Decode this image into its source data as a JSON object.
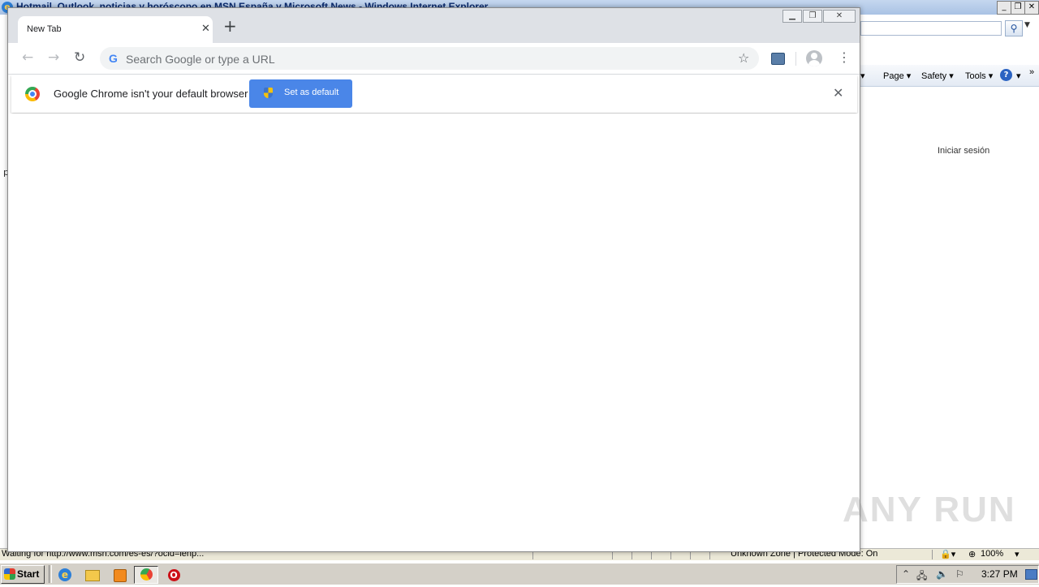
{
  "ie": {
    "title": "Hotmail, Outlook, noticias y horóscopo en MSN España y Microsoft News - Windows Internet Explorer",
    "menu": {
      "page": "Page",
      "safety": "Safety",
      "tools": "Tools"
    },
    "signin": "Iniciar sesión",
    "status": "Waiting for http://www.msn.com/es-es/?ocid=iehp...",
    "zone": "Unknown Zone | Protected Mode: On",
    "zoom": "100%",
    "left_fragment": "p"
  },
  "chrome": {
    "tab_title": "New Tab",
    "omnibox_placeholder": "Search Google or type a URL",
    "omnibox_value": "",
    "infobar_message": "Google Chrome isn't your default browser",
    "set_default_label": "Set as default"
  },
  "taskbar": {
    "start_label": "Start",
    "clock": "3:27 PM"
  },
  "watermark": "ANY RUN"
}
